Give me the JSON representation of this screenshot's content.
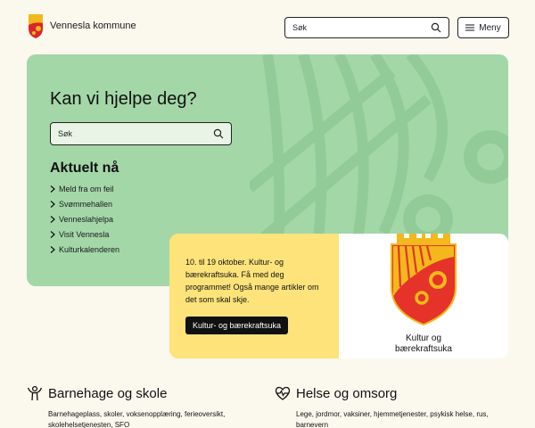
{
  "header": {
    "site_name": "Vennesla kommune",
    "search_placeholder": "Søk",
    "menu_label": "Meny"
  },
  "hero": {
    "title": "Kan vi hjelpe deg?",
    "search_placeholder": "Søk",
    "news_title": "Aktuelt nå",
    "news_items": [
      "Meld fra om feil",
      "Svømmehallen",
      "Venneslahjelpa",
      "Visit Vennesla",
      "Kulturkalenderen"
    ]
  },
  "feature": {
    "text": "10. til 19 oktober. Kultur- og bærekraftsuka. Få med deg programmet! Også mange artikler om det som skal skje.",
    "button_label": "Kultur- og bærekraftsuka",
    "caption_line1": "Kultur og",
    "caption_line2": "bærekraftsuka"
  },
  "categories": [
    {
      "title": "Barnehage og skole",
      "description": "Barnehageplass, skoler, voksenopplæring, ferieoversikt, skolehelsetjenesten, SFO",
      "icon": "child-icon"
    },
    {
      "title": "Helse og omsorg",
      "description": "Lege, jordmor, vaksiner, hjemmetjenester, psykisk helse, rus, barnevern",
      "icon": "heartbeat-icon"
    }
  ],
  "colors": {
    "background": "#fbf8ee",
    "hero_green": "#a3d7a8",
    "feature_yellow": "#fde37a",
    "crest_red": "#d9262b",
    "crest_gold": "#f2b81c"
  }
}
